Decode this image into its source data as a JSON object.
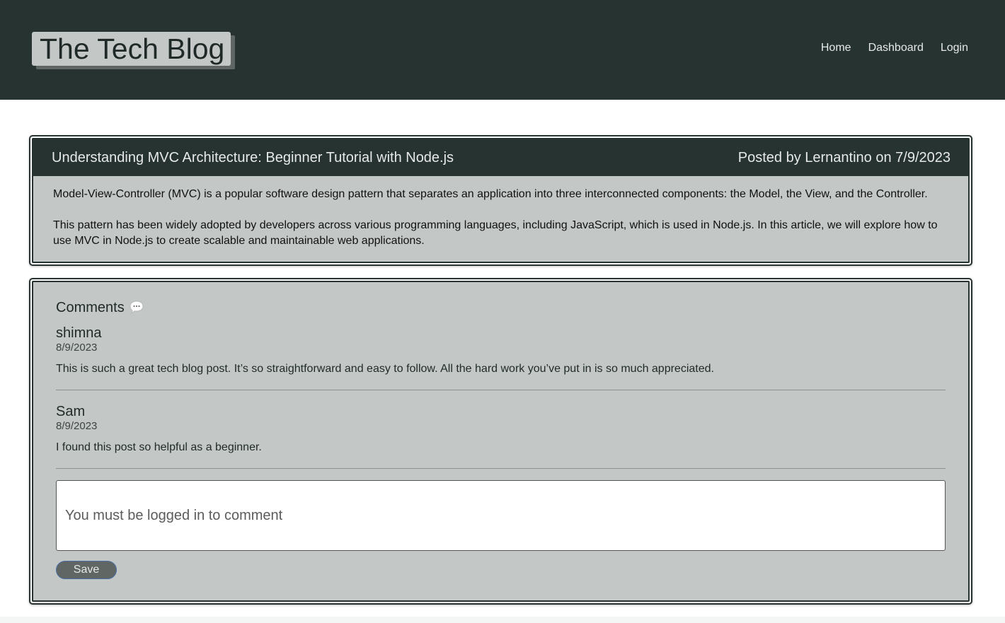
{
  "header": {
    "title": "The Tech Blog",
    "nav": [
      "Home",
      "Dashboard",
      "Login"
    ]
  },
  "post": {
    "title": "Understanding MVC Architecture: Beginner Tutorial with Node.js",
    "meta": "Posted by Lernantino on 7/9/2023",
    "paragraphs": [
      "Model-View-Controller (MVC) is a popular software design pattern that separates an application into three interconnected components: the Model, the View, and the Controller.",
      "This pattern has been widely adopted by developers across various programming languages, including JavaScript, which is used in Node.js. In this article, we will explore how to use MVC in Node.js to create scalable and maintainable web applications."
    ]
  },
  "comments": {
    "title": "Comments",
    "icon": "speech-bubble-icon",
    "items": [
      {
        "author": "shimna",
        "date": "8/9/2023",
        "text": "This is such a great tech blog post. It’s so straightforward and easy to follow. All the hard work you’ve put in is so much appreciated."
      },
      {
        "author": "Sam",
        "date": "8/9/2023",
        "text": "I found this post so helpful as a beginner."
      }
    ],
    "input_placeholder": "You must be logged in to comment",
    "save_label": "Save"
  },
  "colors": {
    "header_bg": "#263331",
    "card_bg": "#c3c7c6",
    "button_bg": "#5f6664"
  }
}
